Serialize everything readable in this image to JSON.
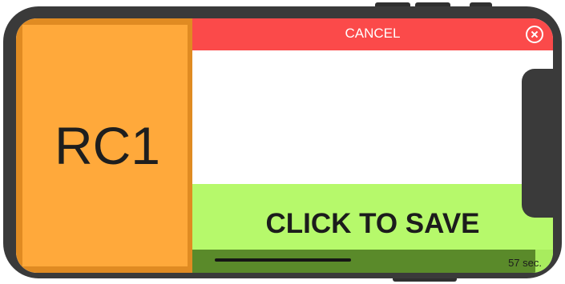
{
  "rc_block": {
    "label": "RC1"
  },
  "cancel_bar": {
    "label": "CANCEL",
    "close_icon": "close-circle-icon"
  },
  "save_area": {
    "label": "CLICK TO SAVE"
  },
  "timer": {
    "text": "57 sec.",
    "progress": 0.95
  },
  "colors": {
    "orange": "#ffa93b",
    "orange_border": "#e08b22",
    "cancel_red": "#fb4a4a",
    "save_green": "#b6f96b",
    "progress_dark_green": "#5a8a2a",
    "device_frame": "#3a3a3a"
  }
}
